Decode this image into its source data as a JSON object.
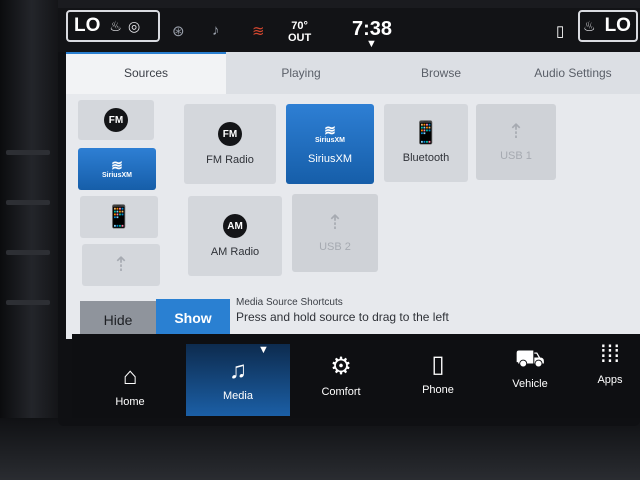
{
  "status": {
    "left_temp": "LO",
    "right_temp": "LO",
    "outside_temp": "70°",
    "outside_label": "OUT",
    "clock": "7:38"
  },
  "tabs": [
    {
      "label": "Sources",
      "active": true
    },
    {
      "label": "Playing",
      "active": false
    },
    {
      "label": "Browse",
      "active": false
    },
    {
      "label": "Audio Settings",
      "active": false
    }
  ],
  "sources": {
    "fm": {
      "badge": "FM",
      "label": "FM Radio"
    },
    "siriusxm": {
      "badge": "SiriusXM",
      "label": "SiriusXM"
    },
    "bluetooth": {
      "label": "Bluetooth"
    },
    "usb1": {
      "label": "USB 1"
    },
    "am": {
      "badge": "AM",
      "label": "AM Radio"
    },
    "usb2": {
      "label": "USB 2"
    }
  },
  "shortcuts": {
    "hide_label": "Hide",
    "show_label": "Show",
    "title": "Media Source Shortcuts",
    "hint": "Press and hold source to drag to the left",
    "items": [
      {
        "type": "fm",
        "badge": "FM"
      },
      {
        "type": "siriusxm",
        "badge": "SiriusXM",
        "selected": true
      },
      {
        "type": "bluetooth"
      },
      {
        "type": "usb"
      }
    ]
  },
  "nav": [
    {
      "label": "Home",
      "icon": "home-icon"
    },
    {
      "label": "Media",
      "icon": "music-note-icon",
      "active": true
    },
    {
      "label": "Comfort",
      "icon": "comfort-icon"
    },
    {
      "label": "Phone",
      "icon": "phone-icon"
    },
    {
      "label": "Vehicle",
      "icon": "car-icon"
    },
    {
      "label": "Apps",
      "icon": "apps-grid-icon"
    }
  ],
  "colors": {
    "accent": "#2a80d2",
    "panel": "#e7e9ed",
    "nav_background": "#0e0f12"
  }
}
